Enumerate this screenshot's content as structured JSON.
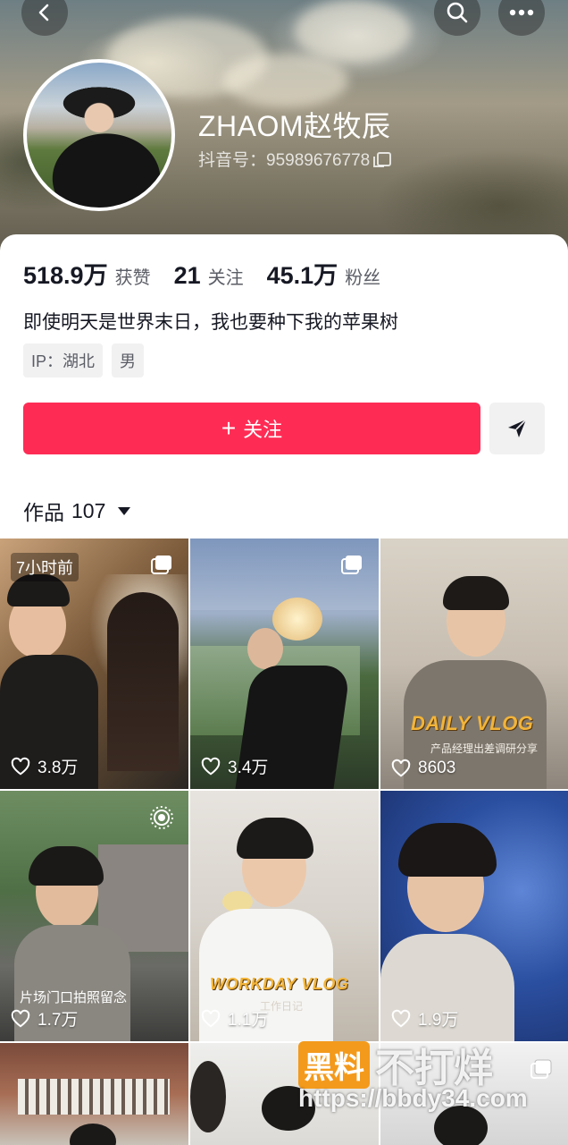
{
  "profile": {
    "name": "ZHAOM赵牧辰",
    "douyin_id": "抖音号：95989676778",
    "likes_num": "518.9万",
    "likes_label": "获赞",
    "following_num": "21",
    "following_label": "关注",
    "fans_num": "45.1万",
    "fans_label": "粉丝",
    "bio": "即使明天是世界末日，我也要种下我的苹果树",
    "tags": [
      "IP：湖北",
      "男"
    ]
  },
  "icons": {
    "back": "chevron-left-icon",
    "search": "search-icon",
    "more": "more-horizontal-icon",
    "copy": "copy-icon",
    "share": "send-icon",
    "heart": "heart-outline-icon",
    "multi": "multi-image-icon",
    "live": "live-photo-icon"
  },
  "actions": {
    "follow_plus": "+",
    "follow_label": "关注"
  },
  "works": {
    "label": "作品",
    "count": "107"
  },
  "videos": [
    {
      "likes": "3.8万",
      "time_badge": "7小时前"
    },
    {
      "likes": "3.4万"
    },
    {
      "likes": "8603",
      "overlay_title": "DAILY VLOG",
      "overlay_sub": "产品经理出差调研分享"
    },
    {
      "likes": "1.7万",
      "caption": "片场门口拍照留念"
    },
    {
      "likes": "1.1万",
      "overlay_title": "WORKDAY VLOG",
      "overlay_sub": "工作日记"
    },
    {
      "likes": "1.9万"
    }
  ],
  "watermark": {
    "box": "黑料",
    "text": "不打烊",
    "url": "https://bbdy34.com"
  },
  "colors": {
    "accent": "#fe2c55",
    "text_primary": "#161823",
    "text_secondary": "#5b5d66",
    "tag_bg": "#f1f1f2"
  }
}
